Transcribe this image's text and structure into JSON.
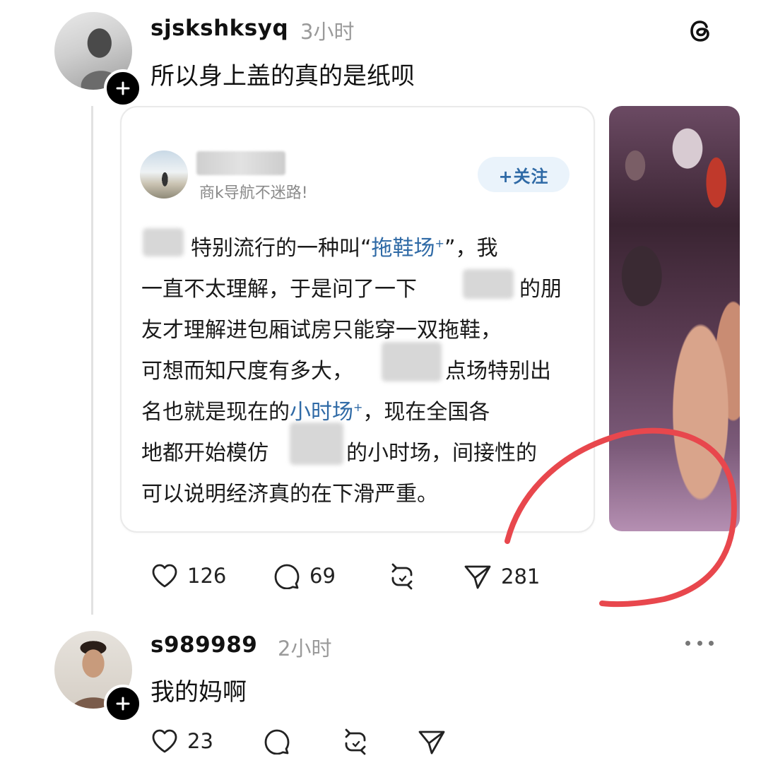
{
  "post1": {
    "username": "sjskshksyq",
    "time": "3小时",
    "text": "所以身上盖的真的是纸呗",
    "avatar_icon": "user-avatar",
    "follow_icon": "plus-icon",
    "app_icon": "threads-logo-icon"
  },
  "quote_card": {
    "subtitle": "商k导航不迷路!",
    "follow_label": "+关注",
    "lines": {
      "l1a": "特别流行的一种叫“",
      "l1b": "拖鞋场",
      "l1c": "”，我",
      "l2a": "一直不太理解，于是问了一下",
      "l2b": "的朋",
      "l3": "友才理解进包厢试房只能穿一双拖鞋，",
      "l4a": "可想而知尺度有多大，",
      "l4b": "点场特别出",
      "l5a": "名也就是现在的",
      "l5b": "小时场",
      "l5c": "，现在全国各",
      "l6a": "地都开始模仿",
      "l6b": "的小时场，间接性的",
      "l7": "可以说明经济真的在下滑严重。"
    },
    "link_mark": "+"
  },
  "post1_actions": {
    "likes": "126",
    "comments": "69",
    "reposts": "",
    "shares": "281"
  },
  "post2": {
    "username": "s989989",
    "time": "2小时",
    "text": "我的妈啊",
    "more_icon": "more-dots-icon"
  },
  "post2_actions": {
    "likes": "23"
  },
  "colors": {
    "link": "#2f6aa6",
    "annotation": "#e8474d",
    "muted": "#9a9a9a"
  }
}
